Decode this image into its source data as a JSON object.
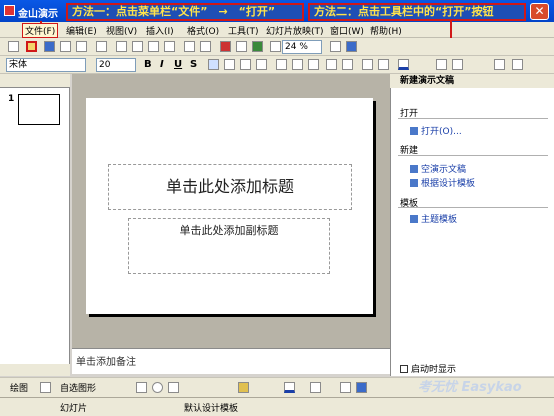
{
  "titlebar": {
    "app_title": "金山演示",
    "close_label": "✕"
  },
  "callouts": {
    "method1": "方法一：点击菜单栏“文件”　→　“打开”",
    "method2": "方法二：点击工具栏中的“打开”按钮"
  },
  "menus": [
    {
      "label": "文件(F)"
    },
    {
      "label": "编辑(E)"
    },
    {
      "label": "视图(V)"
    },
    {
      "label": "插入(I)"
    },
    {
      "label": "格式(O)"
    },
    {
      "label": "工具(T)"
    },
    {
      "label": "幻灯片放映(T)"
    },
    {
      "label": "窗口(W)"
    },
    {
      "label": "帮助(H)"
    }
  ],
  "toolbar": {
    "zoom": "24 %"
  },
  "format_bar": {
    "font": "宋体",
    "size": "20",
    "bold": "B",
    "italic": "I",
    "underline": "U",
    "shadow": "S"
  },
  "slide": {
    "thumb_number": "1",
    "title_placeholder": "单击此处添加标题",
    "subtitle_placeholder": "单击此处添加副标题"
  },
  "notes": {
    "placeholder": "单击添加备注"
  },
  "taskpane": {
    "header": "新建演示文稿",
    "open_section": "打开",
    "open_link": "打开(O)...",
    "new_section": "新建",
    "new_blank": "空演示文稿",
    "new_from_template": "根据设计模板",
    "template_section": "模板",
    "theme_templates": "主题模板",
    "startup_label": "启动时显示"
  },
  "drawbar": {
    "draw": "绘图",
    "autoshapes": "自选图形"
  },
  "status": {
    "slide": "幻灯片",
    "template": "默认设计模板"
  },
  "watermark": "考无忧 Easykao"
}
